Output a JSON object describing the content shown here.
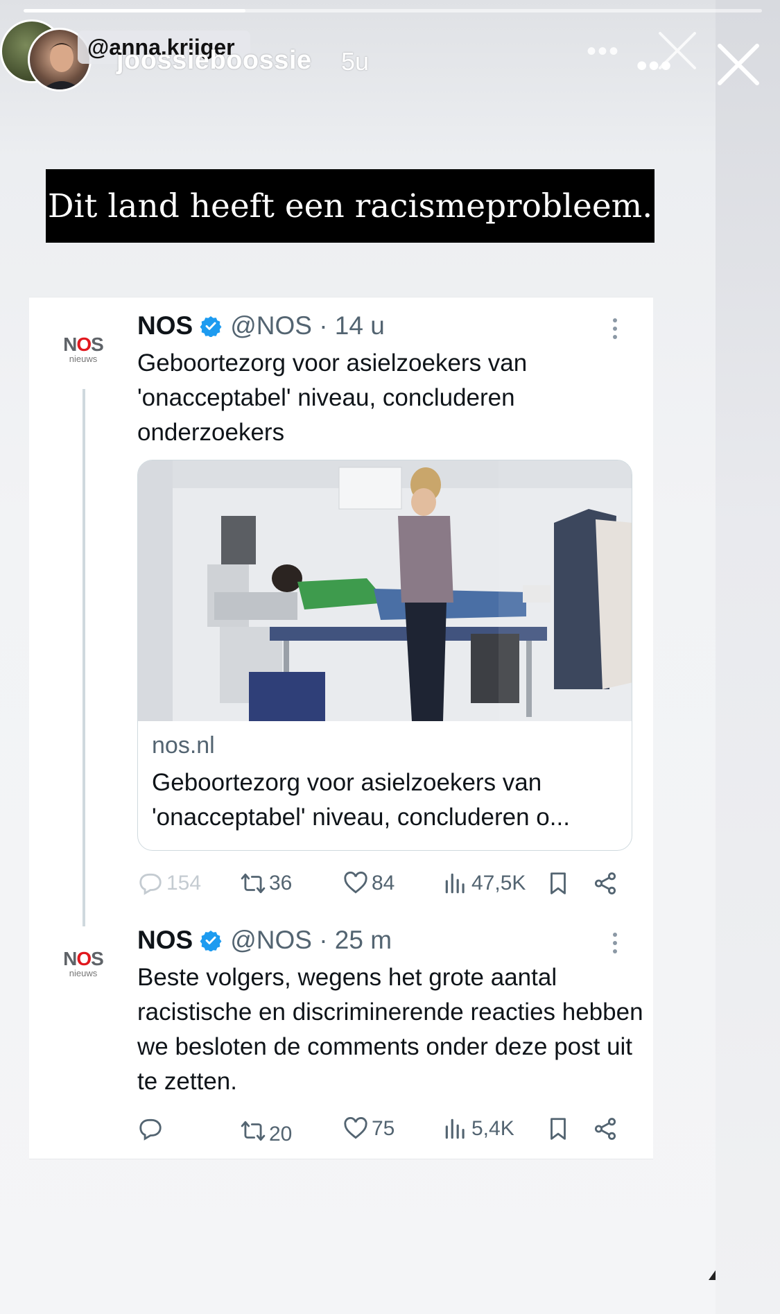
{
  "story": {
    "progress": 0.3,
    "mention_tag": "@anna.kriiger",
    "username": "joossieboossie",
    "time_ago": "5u",
    "more_label": "•••",
    "caption": "Dit land heeft een racismeprobleem."
  },
  "tweets": [
    {
      "author": "NOS",
      "logo_text": "NOS",
      "logo_sub": "nieuws",
      "handle_time": "@NOS · 14 u",
      "text": "Geboortezorg voor asielzoekers van 'onacceptabel' niveau, concluderen onderzoekers",
      "link_domain": "nos.nl",
      "link_title": "Geboortezorg voor asielzoekers van 'onacceptabel' niveau, concluderen o...",
      "replies": "154",
      "retweets": "36",
      "likes": "84",
      "views": "47,5K"
    },
    {
      "author": "NOS",
      "logo_text": "NOS",
      "logo_sub": "nieuws",
      "handle_time": "@NOS · 25 m",
      "text": "Beste volgers, wegens het grote aantal racistische en discriminerende reacties hebben we besloten de comments onder deze post uit te zetten.",
      "replies": "",
      "retweets": "20",
      "likes": "75",
      "views": "5,4K"
    }
  ],
  "colors": {
    "verified_blue": "#1d9bf0",
    "nos_red": "#e1181e",
    "caption_bg": "#000000"
  }
}
